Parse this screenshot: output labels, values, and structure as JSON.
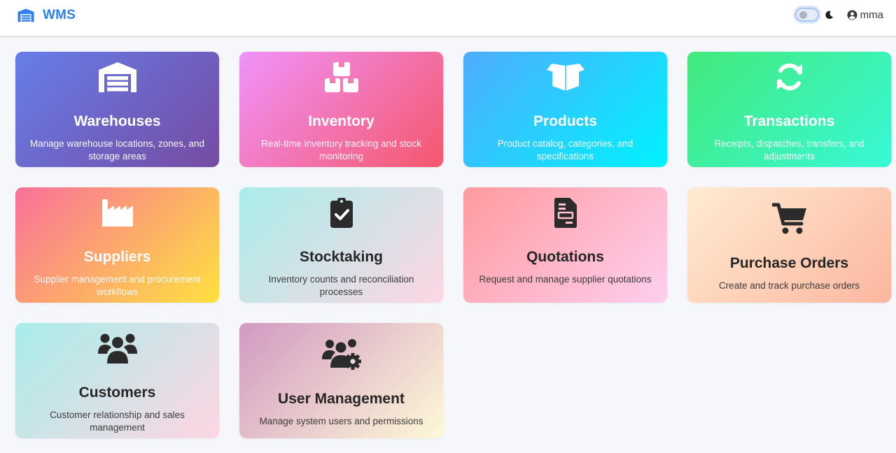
{
  "app": {
    "brand": "WMS",
    "brand_icon": "warehouse-icon"
  },
  "nav": {
    "theme_toggle_icon": "theme-toggle",
    "moon_icon": "moon-icon",
    "user_icon": "user-circle-icon",
    "user_name": "mma"
  },
  "modules": [
    {
      "key": "warehouses",
      "title": "Warehouses",
      "description": "Manage warehouse locations, zones, and storage areas",
      "icon": "warehouse-icon",
      "gradient": [
        "#667eea",
        "#764ba2"
      ]
    },
    {
      "key": "inventory",
      "title": "Inventory",
      "description": "Real-time inventory tracking and stock monitoring",
      "icon": "boxes-icon",
      "gradient": [
        "#f093fb",
        "#f5576c"
      ]
    },
    {
      "key": "products",
      "title": "Products",
      "description": "Product catalog, categories, and specifications",
      "icon": "box-open-icon",
      "gradient": [
        "#4facfe",
        "#00f2fe"
      ]
    },
    {
      "key": "transactions",
      "title": "Transactions",
      "description": "Receipts, dispatches, transfers, and adjustments",
      "icon": "sync-icon",
      "gradient": [
        "#43e97b",
        "#38f9d7"
      ]
    },
    {
      "key": "suppliers",
      "title": "Suppliers",
      "description": "Supplier management and procurement workflows",
      "icon": "industry-icon",
      "gradient": [
        "#fa709a",
        "#fee140"
      ]
    },
    {
      "key": "stocktaking",
      "title": "Stocktaking",
      "description": "Inventory counts and reconciliation processes",
      "icon": "clipboard-check-icon",
      "gradient": [
        "#a8edea",
        "#fed6e3"
      ]
    },
    {
      "key": "quotations",
      "title": "Quotations",
      "description": "Request and manage supplier quotations",
      "icon": "file-invoice-icon",
      "gradient": [
        "#ff9a9e",
        "#fecfef"
      ]
    },
    {
      "key": "purchase_orders",
      "title": "Purchase Orders",
      "description": "Create and track purchase orders",
      "icon": "shopping-cart-icon",
      "gradient": [
        "#ffecd2",
        "#fcb69f"
      ]
    },
    {
      "key": "customers",
      "title": "Customers",
      "description": "Customer relationship and sales management",
      "icon": "users-icon",
      "gradient": [
        "#a8edea",
        "#fed6e3"
      ]
    },
    {
      "key": "user_management",
      "title": "User Management",
      "description": "Manage system users and permissions",
      "icon": "users-cog-icon",
      "gradient": [
        "#d299c2",
        "#fef9d7"
      ]
    }
  ]
}
